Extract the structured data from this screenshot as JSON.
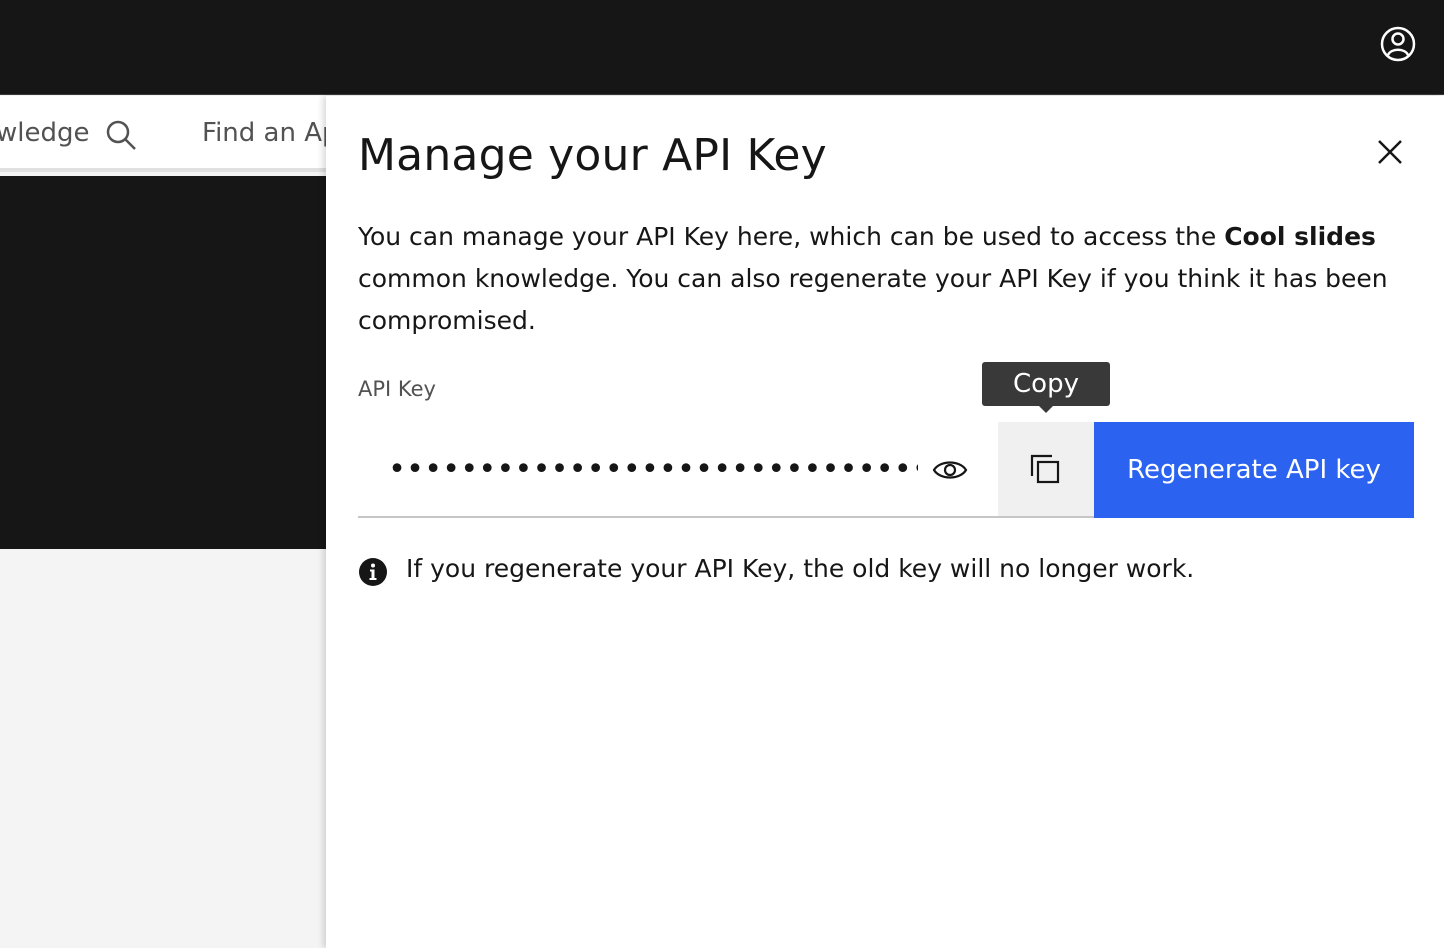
{
  "topbar": {
    "user_icon": "user-avatar-icon"
  },
  "background_nav": {
    "item1_label": "wledge",
    "item2_label": "Find an Ap",
    "search_icon": "search-icon"
  },
  "panel": {
    "title": "Manage your API Key",
    "close_icon": "close-icon",
    "description_part1": "You can manage your API Key here, which can be used to access the ",
    "description_bold": "Cool slides",
    "description_part2": " common knowledge. You can also regenerate your API Key if you think it has been compromised.",
    "field_label": "API Key",
    "masked_value": "•••••••••••••••••••••••••••••••••••••••••",
    "eye_icon": "eye-icon",
    "copy_icon": "copy-icon",
    "copy_tooltip": "Copy",
    "regenerate_label": "Regenerate API key",
    "info_icon": "info-icon",
    "info_text": "If you regenerate your API Key, the old key will no longer work."
  },
  "colors": {
    "topbar": "#161616",
    "primary_button": "#2b63f0",
    "tooltip": "#393939",
    "panel": "#ffffff"
  }
}
